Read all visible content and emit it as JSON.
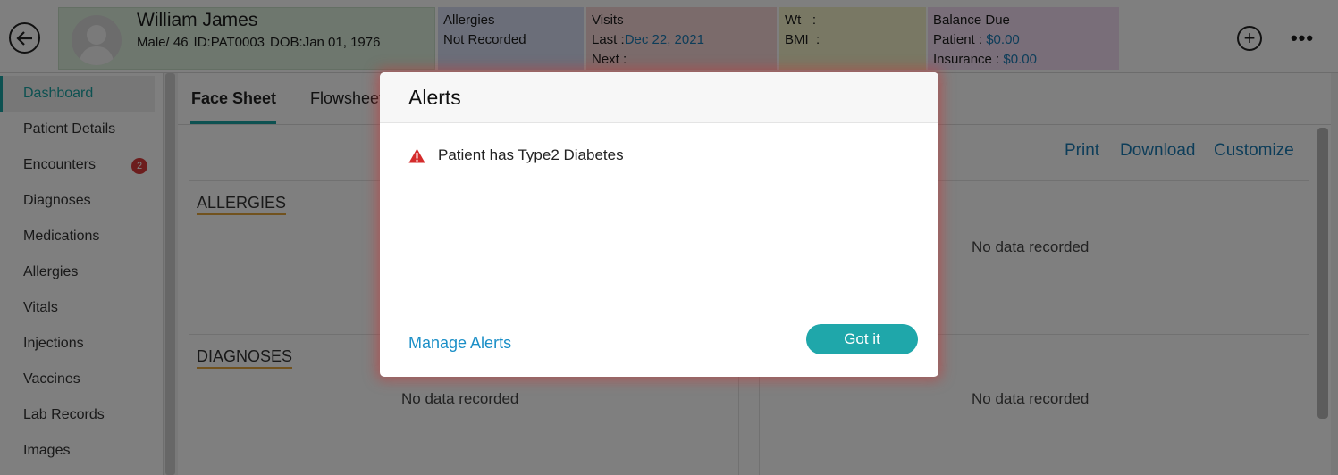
{
  "header": {
    "patient_name": "William James",
    "gender_age": "Male/ 46",
    "patient_id": "ID:PAT0003",
    "dob": "DOB:Jan 01, 1976",
    "allergies_label": "Allergies",
    "allergies_value": "Not Recorded",
    "visits_label": "Visits",
    "last_label": "Last  :",
    "last_value": "Dec 22, 2021",
    "next_label": "Next :",
    "wt_label": "Wt   :",
    "bmi_label": "BMI  :",
    "balance_label": "Balance Due",
    "patient_balance_label": "Patient :",
    "patient_balance_value": "$0.00",
    "insurance_label": "Insurance :",
    "insurance_value": "$0.00"
  },
  "sidebar": {
    "items": [
      {
        "label": "Dashboard"
      },
      {
        "label": "Patient Details"
      },
      {
        "label": "Encounters",
        "badge": "2"
      },
      {
        "label": "Diagnoses"
      },
      {
        "label": "Medications"
      },
      {
        "label": "Allergies"
      },
      {
        "label": "Vitals"
      },
      {
        "label": "Injections"
      },
      {
        "label": "Vaccines"
      },
      {
        "label": "Lab Records"
      },
      {
        "label": "Images"
      }
    ]
  },
  "main": {
    "tabs": [
      {
        "label": "Face Sheet"
      },
      {
        "label": "Flowsheet"
      }
    ],
    "actions": {
      "print": "Print",
      "download": "Download",
      "customize": "Customize"
    },
    "panels": {
      "allergies_title": "ALLERGIES",
      "diagnoses_title": "DIAGNOSES",
      "no_data": "No data recorded"
    }
  },
  "modal": {
    "title": "Alerts",
    "alert_text": "Patient has Type2 Diabetes",
    "manage_link": "Manage Alerts",
    "confirm_button": "Got it"
  },
  "colors": {
    "accent": "#1fa7aa",
    "link": "#1b7ab3",
    "warning": "#d42b2b"
  }
}
